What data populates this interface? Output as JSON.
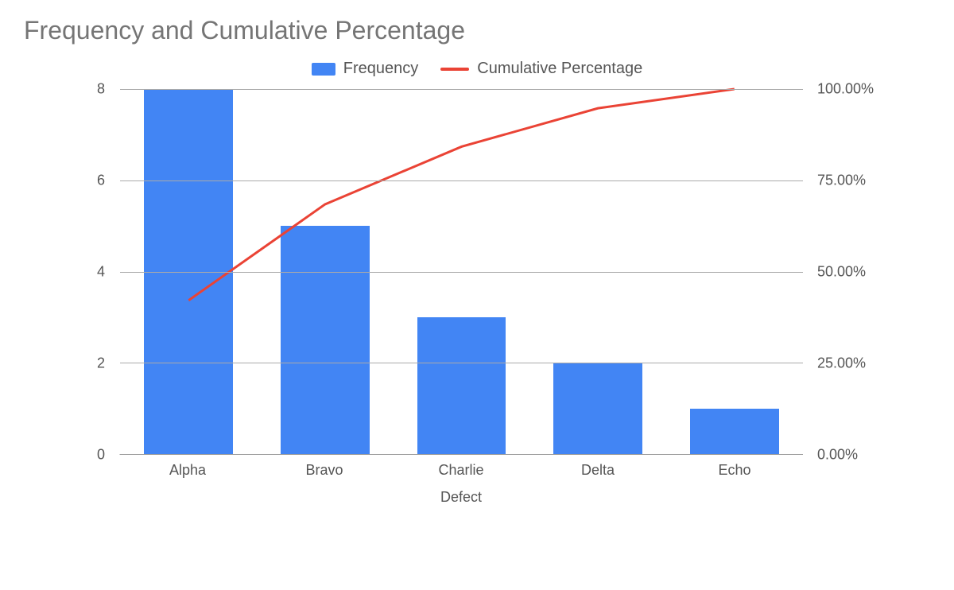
{
  "chart_data": {
    "type": "bar",
    "title": "Frequency and Cumulative Percentage",
    "xlabel": "Defect",
    "categories": [
      "Alpha",
      "Bravo",
      "Charlie",
      "Delta",
      "Echo"
    ],
    "series": [
      {
        "name": "Frequency",
        "kind": "bar",
        "values": [
          8,
          5,
          3,
          2,
          1
        ],
        "axis": "y1",
        "color": "#4285f4"
      },
      {
        "name": "Cumulative Percentage",
        "kind": "line",
        "values": [
          42.11,
          68.42,
          84.21,
          94.74,
          100.0
        ],
        "axis": "y2",
        "color": "#ea4335"
      }
    ],
    "y1": {
      "ticks": [
        0,
        2,
        4,
        6,
        8
      ],
      "min": 0,
      "max": 8
    },
    "y2": {
      "ticks": [
        "0.00%",
        "25.00%",
        "50.00%",
        "75.00%",
        "100.00%"
      ],
      "min": 0,
      "max": 100
    }
  }
}
